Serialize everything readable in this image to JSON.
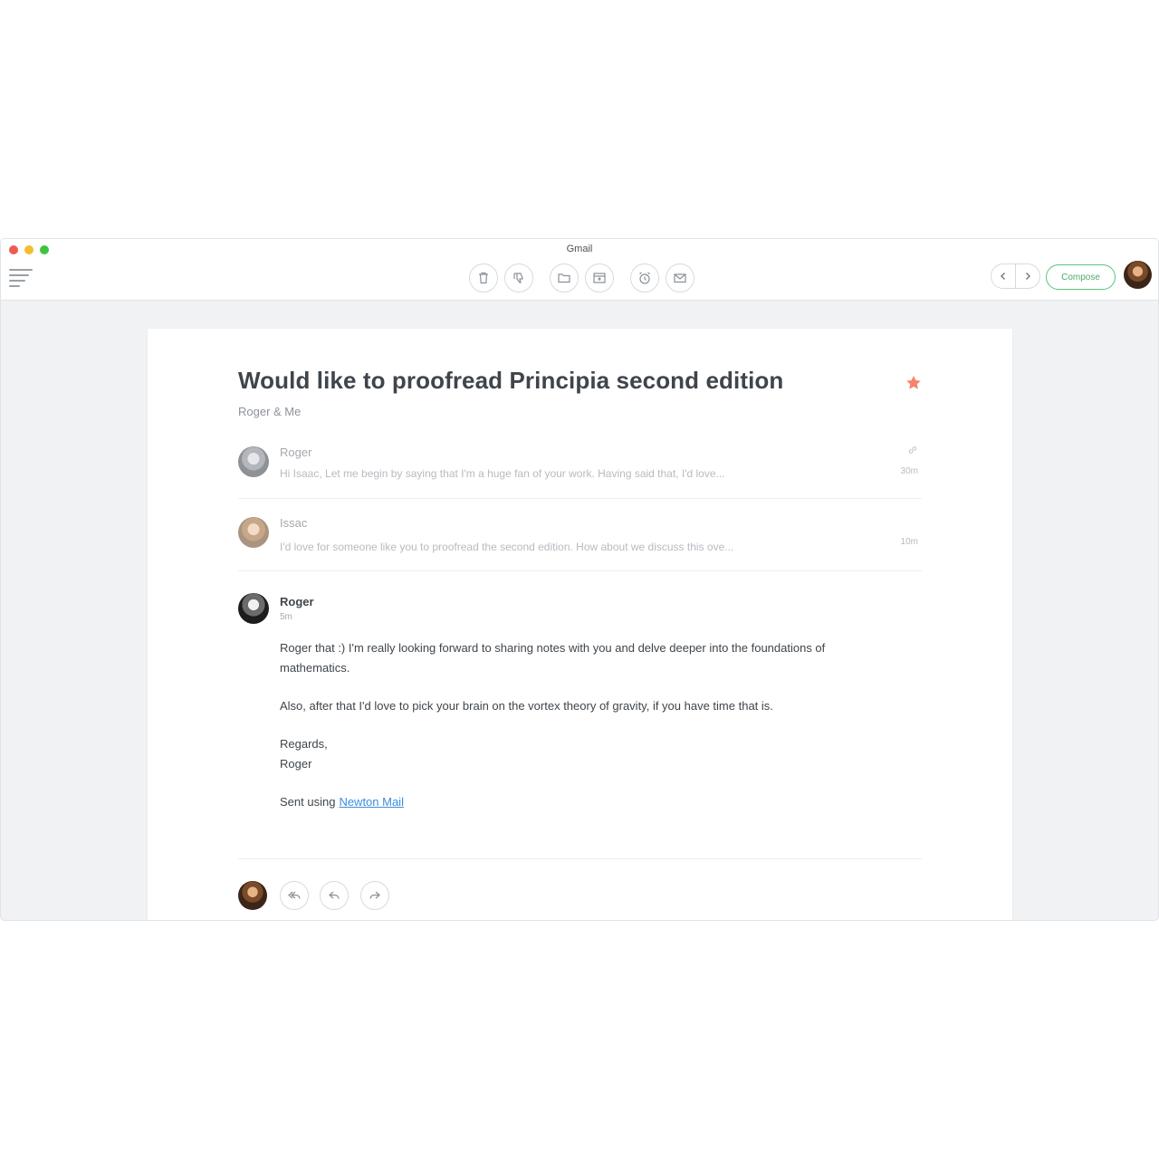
{
  "window": {
    "title": "Gmail"
  },
  "toolbar": {
    "buttons": [
      "trash-icon",
      "thumbs-down-icon",
      "folder-icon",
      "archive-icon",
      "alarm-clock-icon",
      "mail-icon"
    ],
    "compose_label": "Compose"
  },
  "thread": {
    "subject": "Would like to proofread Principia second edition",
    "participants": "Roger & Me",
    "starred": true,
    "star_color": "#f4846a"
  },
  "messages": [
    {
      "sender": "Roger",
      "snippet": "Hi Isaac, Let me begin by saying that I'm a huge fan of your work. Having said that, I'd love...",
      "time": "30m"
    },
    {
      "sender": "Issac",
      "snippet": "I'd love for someone like you to proofread the second edition. How about we discuss this ove...",
      "time": "10m"
    }
  ],
  "open_message": {
    "sender": "Roger",
    "time": "5m",
    "paragraph1": "Roger that :) I'm really looking forward to sharing notes with you and delve deeper into the foundations of mathematics.",
    "paragraph2": "Also, after that I'd love to pick your brain on the vortex theory of gravity, if you have time that is.",
    "regards": "Regards,",
    "signature": "Roger",
    "sent_using": "Sent using",
    "link_text": "Newton Mail"
  },
  "colors": {
    "accent_green": "#4cab6b",
    "link_blue": "#3d8ee0"
  }
}
